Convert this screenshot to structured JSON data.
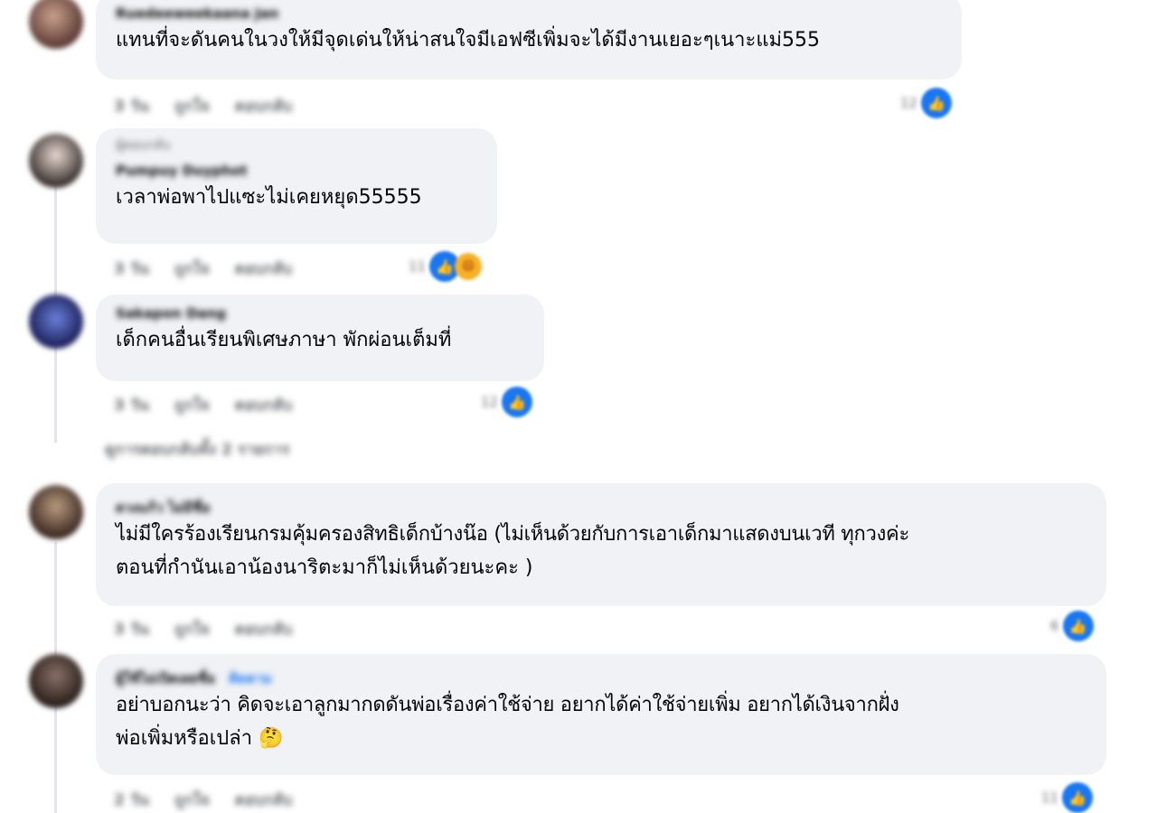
{
  "comments": [
    {
      "author": "Ruedeeweekaana Jan",
      "reply_context": "",
      "lines": [
        "แทนที่จะดันคนในวงให้มีจุดเด่นให้น่าสนใจมีเอฟซีเพิ่มจะได้มีงานเยอะๆเนาะแม่555"
      ],
      "time": "3 วัน",
      "like_label": "ถูกใจ",
      "reply_label": "ตอบกลับ",
      "reaction_count": "12"
    },
    {
      "author": "Pumpuy Duyphot",
      "reply_context": "ผู้ตอบกลับ",
      "lines": [
        "เวลาพ่อพาไปแซะไม่เคยหยุด55555"
      ],
      "time": "3 วัน",
      "like_label": "ถูกใจ",
      "reply_label": "ตอบกลับ",
      "reaction_count": "11"
    },
    {
      "author": "Sakapon Dang",
      "reply_context": "",
      "lines": [
        "เด็กคนอื่นเรียนพิเศษภาษา พักผ่อนเต็มที่"
      ],
      "time": "3 วัน",
      "like_label": "ถูกใจ",
      "reply_label": "ตอบกลับ",
      "reaction_count": "12"
    },
    {
      "author": "ดวงแก้ว ไม่มีชื่อ",
      "reply_context": "",
      "lines": [
        "ไม่มีใครร้องเรียนกรมคุ้มครองสิทธิเด็กบ้างน๊อ (ไม่เห็นด้วยกับการเอาเด็กมาแสดงบนเวที ทุกวงค่ะ",
        "ตอนที่กำนันเอาน้องนาริตะมาก็ไม่เห็นด้วยนะคะ )"
      ],
      "time": "3 วัน",
      "like_label": "ถูกใจ",
      "reply_label": "ตอบกลับ",
      "reaction_count": "6"
    },
    {
      "author": "ผู้ใช้ไม่เปิดเผยชื่อ",
      "badge": "ติดตาม",
      "reply_context": "",
      "lines": [
        "อย่าบอกนะว่า คิดจะเอาลูกมากดดันพ่อเรื่องค่าใช้จ่าย อยากได้ค่าใช้จ่ายเพิ่ม อยากได้เงินจากฝั่ง",
        "พ่อเพิ่มหรือเปล่า"
      ],
      "emoji": "🤔",
      "time": "2 วัน",
      "like_label": "ถูกใจ",
      "reply_label": "ตอบกลับ",
      "reaction_count": "11"
    }
  ],
  "view_more_replies": "ดูการตอบกลับทั้ง 2 รายการ",
  "icons": {
    "like": "like-reaction-icon",
    "haha": "haha-reaction-icon"
  },
  "colors": {
    "bubble": "#f0f2f5",
    "like_blue": "#1877f2",
    "meta_gray": "#65676b"
  }
}
